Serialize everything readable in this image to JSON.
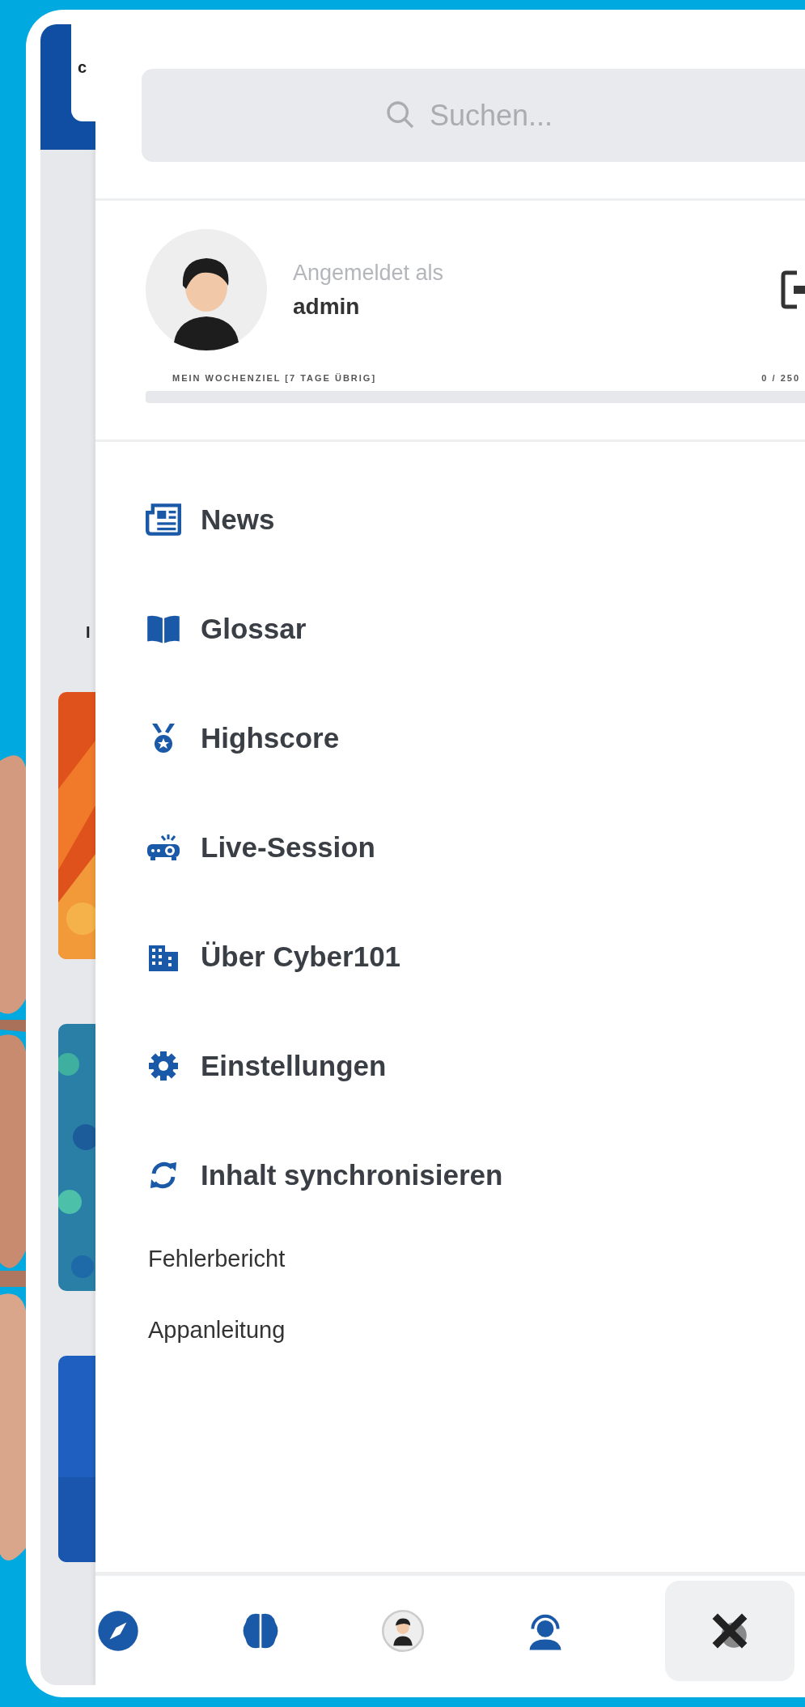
{
  "background_fragments": [
    {
      "text": "c"
    },
    {
      "text": "I"
    }
  ],
  "search": {
    "placeholder": "Suchen..."
  },
  "profile": {
    "caption": "Angemeldet als",
    "username": "admin"
  },
  "weekly_goal": {
    "label": "MEIN WOCHENZIEL [7 TAGE ÜBRIG]",
    "count": "0 / 250",
    "level": 0
  },
  "menu": [
    {
      "label": "News",
      "kind": "news"
    },
    {
      "label": "Glossar",
      "kind": "book"
    },
    {
      "label": "Highscore",
      "kind": "medal"
    },
    {
      "label": "Live-Session",
      "kind": "projector"
    },
    {
      "label": "Über Cyber101",
      "kind": "building"
    },
    {
      "label": "Einstellungen",
      "kind": "gear"
    },
    {
      "label": "Inhalt synchronisieren",
      "kind": "sync"
    }
  ],
  "links": [
    "Fehlerbericht",
    "Appanleitung"
  ],
  "bottom_nav": [
    {
      "kind": "compass",
      "selected": false
    },
    {
      "kind": "brain",
      "selected": false
    },
    {
      "kind": "avatar",
      "selected": false
    },
    {
      "kind": "headset",
      "selected": false
    },
    {
      "kind": "close",
      "selected": true
    }
  ]
}
